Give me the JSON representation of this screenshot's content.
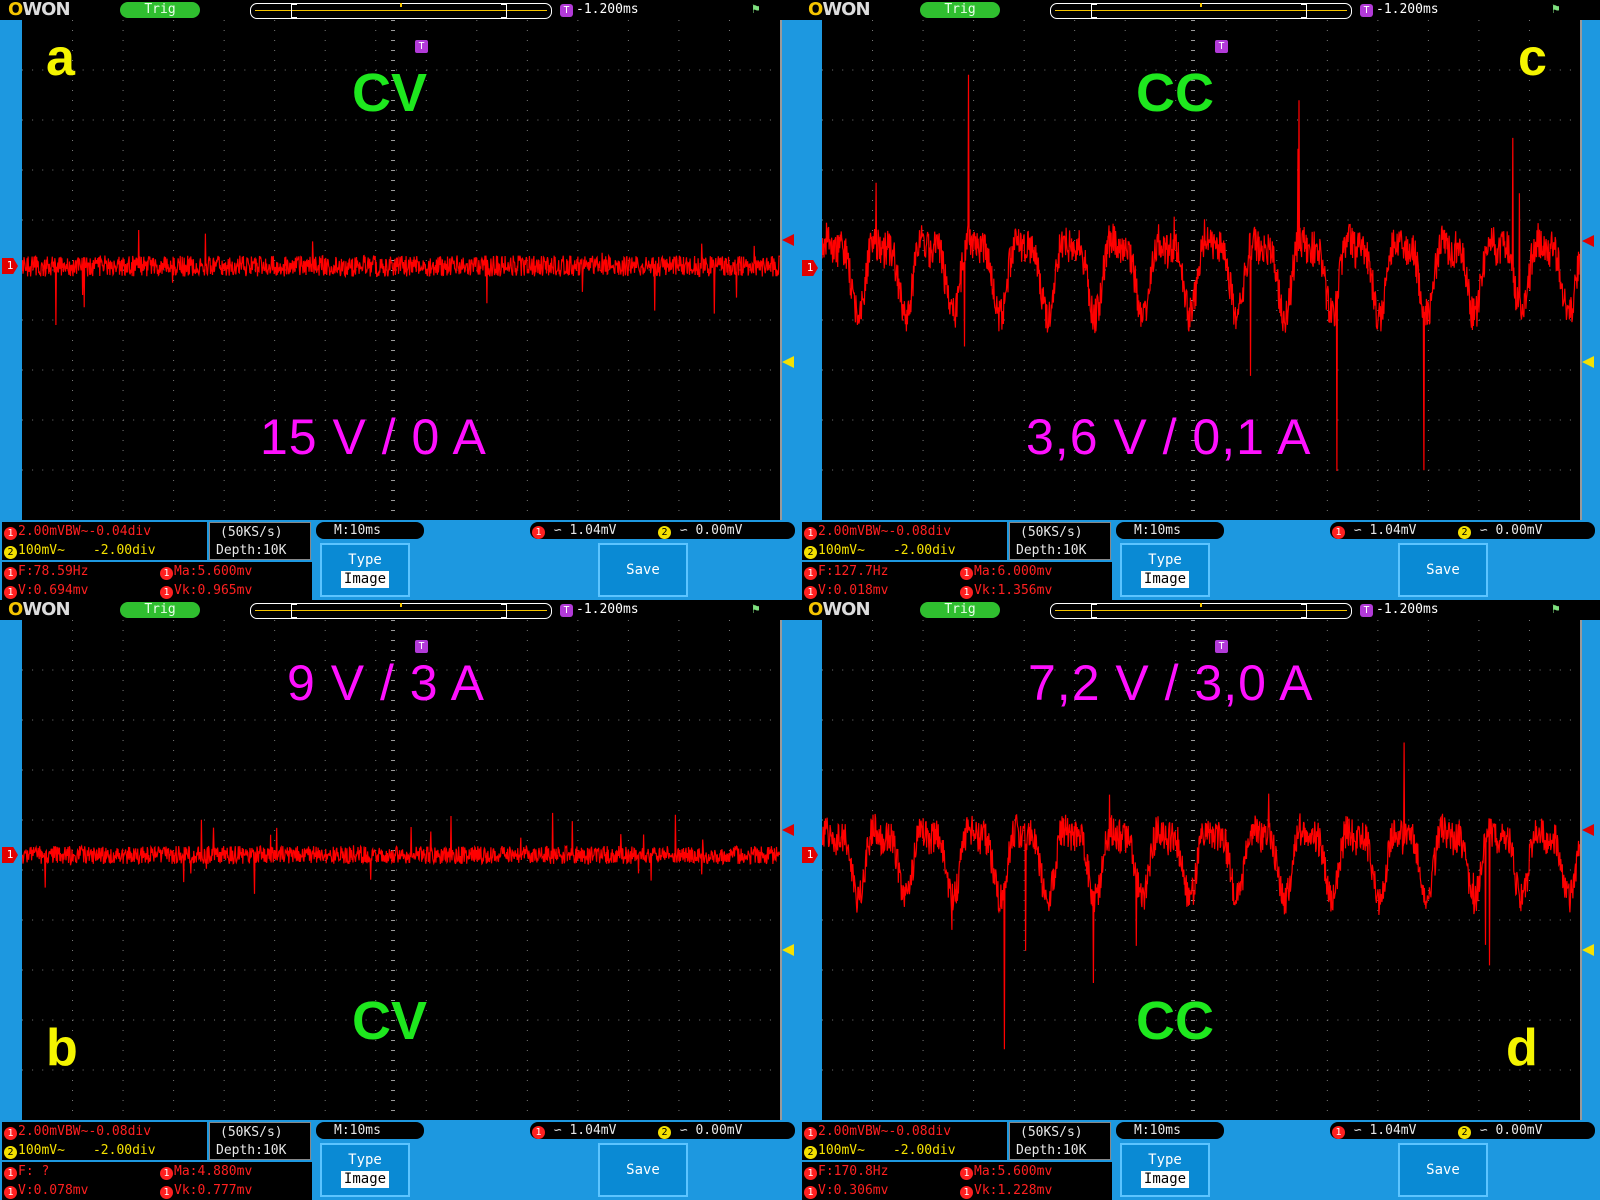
{
  "common": {
    "logo": "OWON",
    "trig_status": "Trig",
    "trigger_position": "-1.200ms",
    "trigger_marker": "T",
    "ch1_marker": "1",
    "ch2_marker": "2",
    "sample_rate": "(50KS/s)",
    "depth": "Depth:10K",
    "timebase": "M:10ms",
    "ch1_trigger_level": "1.04mV",
    "ch2_trigger_level": "0.00mV",
    "type_button": {
      "label": "Type",
      "value": "Image"
    },
    "save_button": "Save",
    "ch2_scale": "100mV~",
    "ch2_offset": "-2.00div",
    "trace_color": "#ff0000",
    "mode_color": "#1ee81e",
    "vi_color": "#ff10ff"
  },
  "panels": [
    {
      "letter": "a",
      "mode": "CV",
      "vi": "15 V / 0 A",
      "ch1_scale": "2.00mVBW~-0.04div",
      "freq": "F:78.59Hz",
      "max": "Ma:5.600mv",
      "vrms": "V:0.694mv",
      "vpk": "Vk:0.965mv"
    },
    {
      "letter": "c",
      "mode": "CC",
      "vi": "3,6 V / 0,1 A",
      "ch1_scale": "2.00mVBW~-0.08div",
      "freq": "F:127.7Hz",
      "max": "Ma:6.000mv",
      "vrms": "V:0.018mv",
      "vpk": "Vk:1.356mv"
    },
    {
      "letter": "b",
      "mode": "CV",
      "vi": "9 V / 3 A",
      "ch1_scale": "2.00mVBW~-0.08div",
      "freq": "F:  ?",
      "max": "Ma:4.880mv",
      "vrms": "V:0.078mv",
      "vpk": "Vk:0.777mv"
    },
    {
      "letter": "d",
      "mode": "CC",
      "vi": "7,2 V / 3,0 A",
      "ch1_scale": "2.00mVBW~-0.08div",
      "freq": "F:170.8Hz",
      "max": "Ma:5.600mv",
      "vrms": "V:0.306mv",
      "vpk": "Vk:1.228mv"
    }
  ],
  "chart_data": [
    {
      "type": "line",
      "panel": "a",
      "mode": "CV",
      "vi": "15 V / 0 A",
      "amplitude_div": 0.35,
      "spikes": true,
      "periodic": false
    },
    {
      "type": "line",
      "panel": "c",
      "mode": "CC",
      "vi": "3,6 V / 0,1 A",
      "amplitude_div": 1.2,
      "spikes": true,
      "periodic": true,
      "peaks": 16
    },
    {
      "type": "line",
      "panel": "b",
      "mode": "CV",
      "vi": "9 V / 3 A",
      "amplitude_div": 0.3,
      "spikes": true,
      "periodic": false
    },
    {
      "type": "line",
      "panel": "d",
      "mode": "CC",
      "vi": "7,2 V / 3,0 A",
      "amplitude_div": 1.1,
      "spikes": true,
      "periodic": true,
      "peaks": 16
    }
  ]
}
